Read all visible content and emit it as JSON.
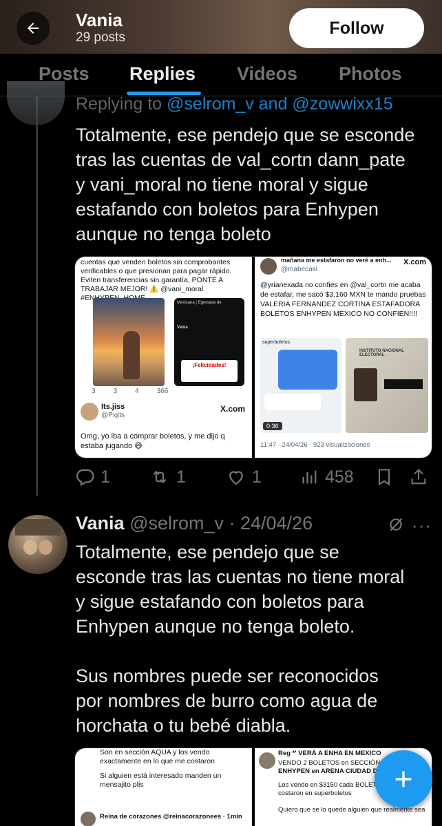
{
  "header": {
    "name": "Vania",
    "posts": "29 posts",
    "follow_label": "Follow"
  },
  "tabs": [
    {
      "label": "Posts",
      "active": false
    },
    {
      "label": "Replies",
      "active": true
    },
    {
      "label": "Videos",
      "active": false
    },
    {
      "label": "Photos",
      "active": false
    }
  ],
  "reply1": {
    "replying_prefix": "Replying to ",
    "replying_handles": "@selrom_v and @zowwixx15",
    "text": "Totalmente, ese pendejo que se esconde\ntras las cuentas de val_cortn dann_pate\ny vani_moral no tiene moral y sigue\nestafando con boletos para Enhypen\naunque no tenga boleto",
    "media_left": {
      "top_text": "cuentas que venden boletos sin comprobantes verificables o que presionan para pagar rápido. Eviten transferencias sin garantía, PONTE A TRABAJAR MEJOR! ⚠️ @vani_moral #ENHYPEN_HOME",
      "inner_name": "Vania",
      "inner_caption": "Mexicana | Egresada de",
      "inner_felicidades": "¡Felicidades!",
      "stats": [
        "3",
        "3",
        "4",
        "366"
      ],
      "user_name": "Its.jiss",
      "user_handle": "@Pxjits",
      "source": "X.com",
      "bottom_text": "Omg, yo iba a comprar boletos, y me dijo q estaba jugando 😅"
    },
    "media_right": {
      "top_partial": "mañana me estafaron no veré a enh...",
      "handle": "@mabecasi",
      "source": "X.com",
      "body_text": "@yrianexada no confies en @val_cortn me acaba de estafar, me sacó $3,160 MXN te mando pruebas VALERIA FERNANDEZ CORTINA ESTAFADORA BOLETOS ENHYPEN MEXICO NO CONFIEN!!!!",
      "chat_title": "superboletos",
      "video_time": "0:36",
      "footer": "11:47 · 24/04/26 · 923 visualizaciones",
      "id_title": "INSTITUTO NACIONAL ELECTORAL"
    },
    "actions": {
      "replies": "1",
      "reposts": "1",
      "likes": "1",
      "views": "458"
    }
  },
  "tweet2": {
    "name": "Vania",
    "meta": "@selrom_v · 24/04/26",
    "text": "Totalmente, ese pendejo que se\nesconde tras las cuentas no tiene moral\ny sigue estafando con boletos para\nEnhypen aunque no tenga boleto.\n\nSus nombres puede ser reconocidos\npor nombres de burro como agua de\nhorchata o tu bebé diabla.",
    "media_left": {
      "text1": "Son en sección AQUA y los vendo exactamente en lo que me costaron",
      "text2": "Si alguien está interesado manden un mensajito plis",
      "user_line": "Reina de corazones @reinacorazonees · 1min"
    },
    "media_right": {
      "user_line": "Reg *' VERÁ A ENHA EN MEXICO",
      "text1": "VENDO 2 BOLETOS en SECCIÓN",
      "text2": "ENHYPEN en ARENA CIUDAD DE",
      "text3": "Los vendo en $3150 cada BOLET",
      "text4": "costaron en superboletos",
      "text5": "Quiero que se lo quede alguien que realmente sea"
    }
  },
  "colors": {
    "accent": "#1d9bf0",
    "muted": "#71767b",
    "text": "#e7e9ea"
  }
}
